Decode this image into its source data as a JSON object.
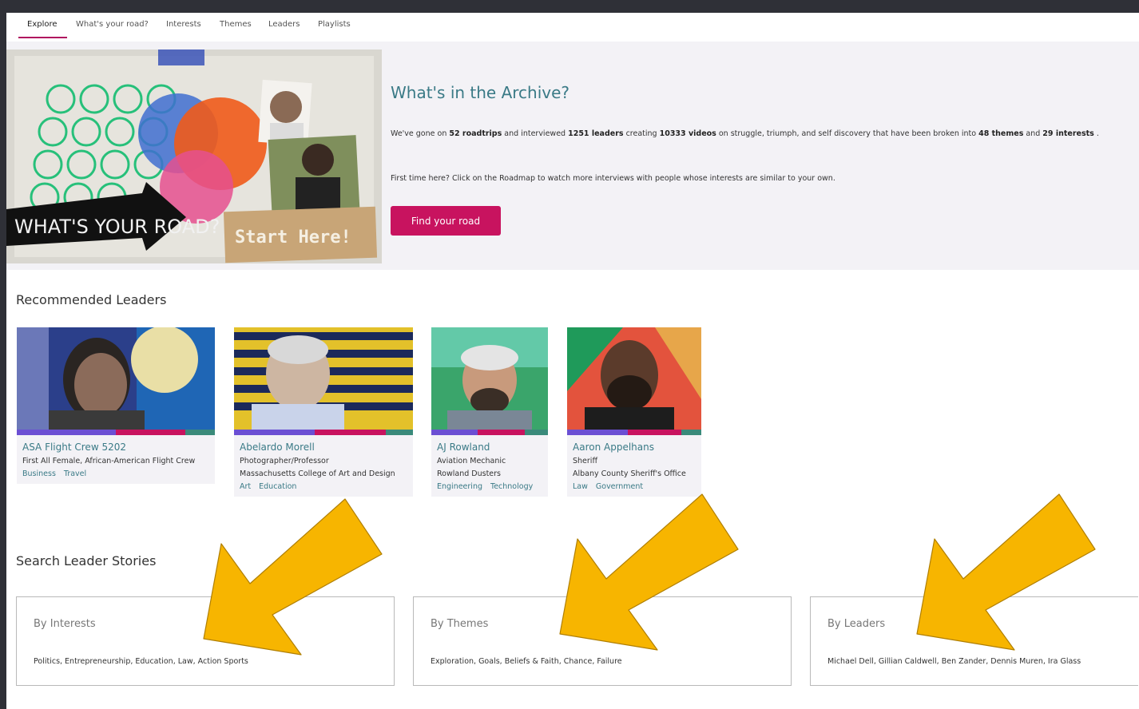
{
  "nav": {
    "items": [
      {
        "label": "Explore"
      },
      {
        "label": "What's your road?"
      },
      {
        "label": "Interests"
      },
      {
        "label": "Themes"
      },
      {
        "label": "Leaders"
      },
      {
        "label": "Playlists"
      }
    ]
  },
  "hero": {
    "image_text": {
      "road": "WHAT'S YOUR ROAD?",
      "start": "Start Here!"
    },
    "title": "What's in the Archive?",
    "desc": {
      "p1": "We've gone on ",
      "roadtrips": "52 roadtrips",
      "p2": " and interviewed ",
      "leaders": "1251 leaders",
      "p3": " creating ",
      "videos": "10333 videos",
      "p4": " on struggle, triumph, and self discovery that have been broken into ",
      "themes": "48 themes",
      "p5": " and ",
      "interests": "29 interests",
      "p6": " ."
    },
    "first_time": "First time here? Click on the Roadmap to watch more interviews with people whose interests are similar to your own.",
    "button": "Find your road"
  },
  "recommended": {
    "title": "Recommended Leaders",
    "leaders": [
      {
        "name": "ASA Flight Crew 5202",
        "line1": "First All Female, African-American Flight Crew",
        "line2": "",
        "tags": [
          "Business",
          "Travel"
        ]
      },
      {
        "name": "Abelardo Morell",
        "line1": "Photographer/Professor",
        "line2": "Massachusetts College of Art and Design",
        "tags": [
          "Art",
          "Education"
        ]
      },
      {
        "name": "AJ Rowland",
        "line1": "Aviation Mechanic",
        "line2": "Rowland Dusters",
        "tags": [
          "Engineering",
          "Technology"
        ]
      },
      {
        "name": "Aaron Appelhans",
        "line1": "Sheriff",
        "line2": "Albany County Sheriff's Office",
        "tags": [
          "Law",
          "Government"
        ]
      }
    ]
  },
  "search": {
    "title": "Search Leader Stories",
    "boxes": [
      {
        "title": "By Interests",
        "list": "Politics, Entrepreneurship, Education, Law, Action Sports"
      },
      {
        "title": "By Themes",
        "list": "Exploration, Goals, Beliefs & Faith, Chance, Failure"
      },
      {
        "title": "By Leaders",
        "list": "Michael Dell, Gillian Caldwell, Ben Zander, Dennis Muren, Ira Glass"
      }
    ]
  },
  "colors": {
    "accent": "#c8135f",
    "teal": "#3a7a86",
    "hero_bg": "#f3f2f6",
    "arrow": "#f7b500",
    "card_bar": [
      "#6b4fd3",
      "#c8135f",
      "#3a8a7a"
    ]
  },
  "annotation": {
    "arrow_count": 3
  }
}
